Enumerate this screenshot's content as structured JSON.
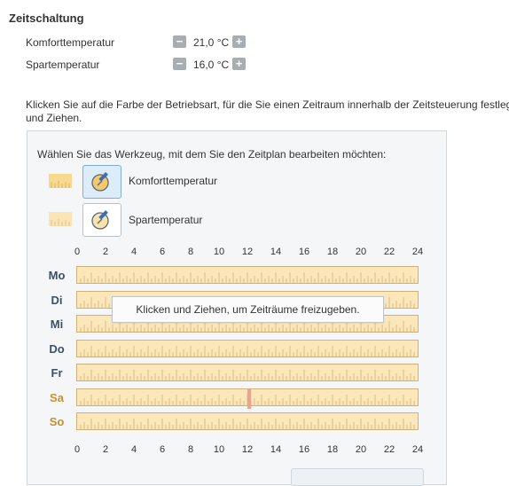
{
  "section": {
    "title": "Zeitschaltung"
  },
  "temperatures": [
    {
      "label": "Komforttemperatur",
      "value": "21,0 °C",
      "minus": "−",
      "plus": "+"
    },
    {
      "label": "Spartemperatur",
      "value": "16,0 °C",
      "minus": "−",
      "plus": "+"
    }
  ],
  "instruction": {
    "line1": "Klicken Sie auf die Farbe der Betriebsart, für die Sie einen Zeitraum innerhalb der Zeitsteuerung festleg",
    "line2": "und Ziehen."
  },
  "tools": {
    "prompt": "Wählen Sie das Werkzeug, mit dem Sie den Zeitplan bearbeiten möchten:",
    "items": [
      {
        "label": "Komforttemperatur",
        "icon": "pencil-thermostat-icon",
        "selected": true,
        "color": "#f9d98e"
      },
      {
        "label": "Spartemperatur",
        "icon": "pencil-thermostat-icon",
        "selected": false,
        "color": "#fbe4b6"
      }
    ]
  },
  "schedule": {
    "hours": [
      "0",
      "2",
      "4",
      "6",
      "8",
      "10",
      "12",
      "14",
      "16",
      "18",
      "20",
      "22",
      "24"
    ],
    "days": [
      {
        "label": "Mo",
        "weekend": false
      },
      {
        "label": "Di",
        "weekend": false
      },
      {
        "label": "Mi",
        "weekend": false
      },
      {
        "label": "Do",
        "weekend": false
      },
      {
        "label": "Fr",
        "weekend": false
      },
      {
        "label": "Sa",
        "weekend": true
      },
      {
        "label": "So",
        "weekend": true
      }
    ],
    "tooltip": "Klicken und Ziehen, um Zeiträume freizugeben.",
    "colors": {
      "eco": "#fbe7b9",
      "weekday": "#3d4f66",
      "weekend": "#c8902f",
      "marker": "#f0a090"
    }
  }
}
